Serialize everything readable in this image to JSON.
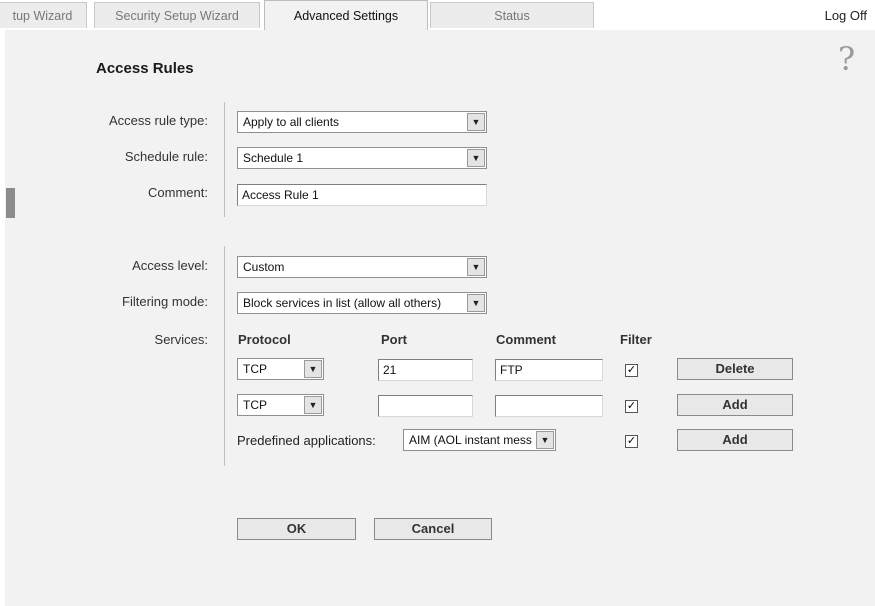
{
  "tabs": [
    {
      "label": "tup Wizard"
    },
    {
      "label": "Security Setup Wizard"
    },
    {
      "label": "Advanced Settings"
    },
    {
      "label": "Status"
    }
  ],
  "logoff_label": "Log Off",
  "help_glyph": "?",
  "page_title": "Access Rules",
  "form": {
    "access_rule_type": {
      "label": "Access rule type:",
      "value": "Apply to all clients"
    },
    "schedule_rule": {
      "label": "Schedule rule:",
      "value": "Schedule 1"
    },
    "comment": {
      "label": "Comment:",
      "value": "Access Rule 1"
    },
    "access_level": {
      "label": "Access level:",
      "value": "Custom"
    },
    "filtering_mode": {
      "label": "Filtering mode:",
      "value": "Block services in list (allow all others)"
    },
    "services_label": "Services:"
  },
  "services": {
    "headers": {
      "protocol": "Protocol",
      "port": "Port",
      "comment": "Comment",
      "filter": "Filter"
    },
    "rows": [
      {
        "protocol": "TCP",
        "port": "21",
        "comment": "FTP",
        "filter_checked": "✓",
        "action": "Delete"
      },
      {
        "protocol": "TCP",
        "port": "",
        "comment": "",
        "filter_checked": "✓",
        "action": "Add"
      }
    ],
    "predefined": {
      "label": "Predefined applications:",
      "value": "AIM (AOL instant mess",
      "filter_checked": "✓",
      "action": "Add"
    }
  },
  "buttons": {
    "ok": "OK",
    "cancel": "Cancel"
  },
  "dropdown_glyph": "▼"
}
